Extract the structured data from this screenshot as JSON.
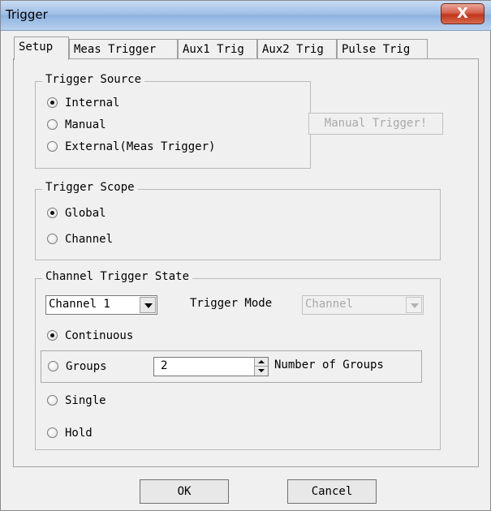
{
  "window": {
    "title": "Trigger",
    "close_label": "X"
  },
  "tabs": [
    "Setup",
    "Meas Trigger",
    "Aux1 Trig",
    "Aux2 Trig",
    "Pulse Trig"
  ],
  "trigger_source": {
    "title": "Trigger Source",
    "options": [
      "Internal",
      "Manual",
      "External(Meas Trigger)"
    ],
    "selected": "Internal",
    "manual_button": "Manual Trigger!"
  },
  "trigger_scope": {
    "title": "Trigger Scope",
    "options": [
      "Global",
      "Channel"
    ],
    "selected": "Global"
  },
  "channel_state": {
    "title": "Channel Trigger State",
    "channel_select": "Channel 1",
    "mode_label": "Trigger Mode",
    "mode_select": "Channel",
    "continuous": "Continuous",
    "groups": "Groups",
    "groups_value": "2",
    "groups_label": "Number of Groups",
    "single": "Single",
    "hold": "Hold",
    "selected": "Continuous"
  },
  "footer": {
    "ok": "OK",
    "cancel": "Cancel"
  }
}
